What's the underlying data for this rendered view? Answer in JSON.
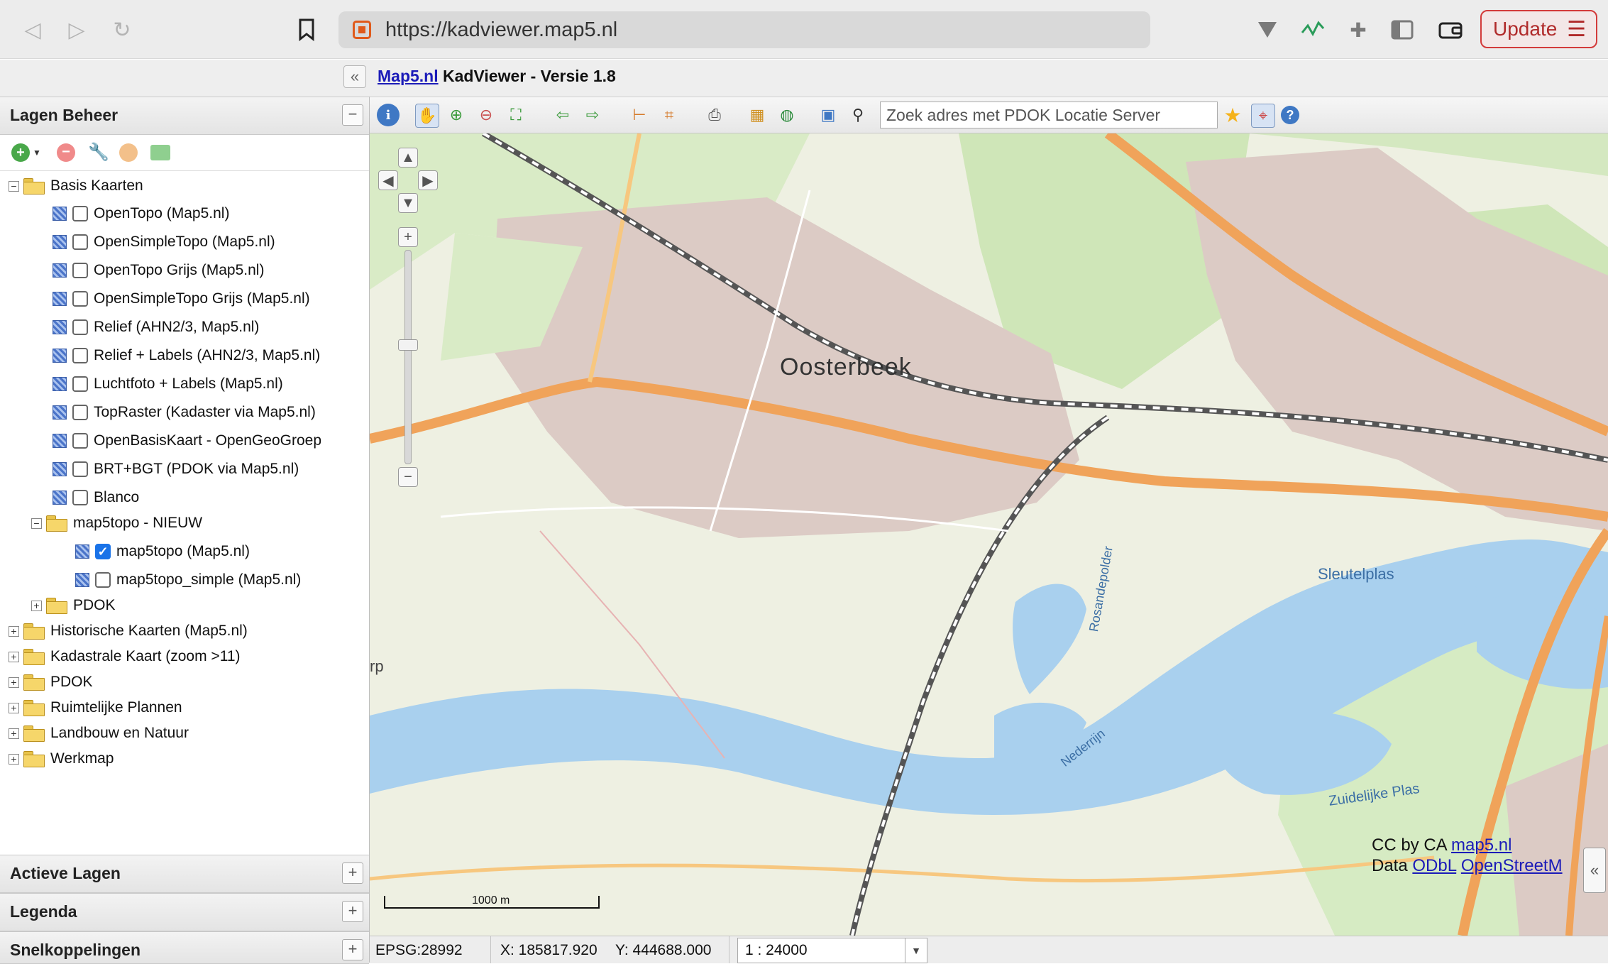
{
  "browser": {
    "url": "https://kadviewer.map5.nl",
    "update_label": "Update"
  },
  "app": {
    "title_link": "Map5.nl",
    "title_rest": " KadViewer - Versie 1.8"
  },
  "left_panel": {
    "title": "Lagen Beheer",
    "tree": {
      "basis_kaarten": "Basis Kaarten",
      "layers": [
        {
          "label": "OpenTopo (Map5.nl)",
          "checked": false
        },
        {
          "label": "OpenSimpleTopo (Map5.nl)",
          "checked": false
        },
        {
          "label": "OpenTopo Grijs (Map5.nl)",
          "checked": false
        },
        {
          "label": "OpenSimpleTopo Grijs (Map5.nl)",
          "checked": false
        },
        {
          "label": "Relief (AHN2/3, Map5.nl)",
          "checked": false
        },
        {
          "label": "Relief + Labels (AHN2/3, Map5.nl)",
          "checked": false
        },
        {
          "label": "Luchtfoto + Labels (Map5.nl)",
          "checked": false
        },
        {
          "label": "TopRaster (Kadaster via Map5.nl)",
          "checked": false
        },
        {
          "label": "OpenBasisKaart - OpenGeoGroep",
          "checked": false
        },
        {
          "label": "BRT+BGT (PDOK via Map5.nl)",
          "checked": false
        },
        {
          "label": "Blanco",
          "checked": false
        }
      ],
      "map5topo_folder": "map5topo - NIEUW",
      "map5topo_layers": [
        {
          "label": "map5topo (Map5.nl)",
          "checked": true
        },
        {
          "label": "map5topo_simple (Map5.nl)",
          "checked": false
        }
      ],
      "pdok_sub": "PDOK",
      "top_folders": [
        "Historische Kaarten (Map5.nl)",
        "Kadastrale Kaart (zoom >11)",
        "PDOK",
        "Ruimtelijke Plannen",
        "Landbouw en Natuur",
        "Werkmap"
      ]
    },
    "bottom_panels": [
      "Actieve Lagen",
      "Legenda",
      "Snelkoppelingen"
    ]
  },
  "map": {
    "search_placeholder": "Zoek adres met PDOK Locatie Server",
    "labels": {
      "town": "Oosterbeek",
      "sleutelplas": "Sleutelplas",
      "rosandepolder": "Rosandepolder",
      "nederrijn": "Nederrijn",
      "zuidelijke_plas": "Zuidelijke Plas",
      "rp": "rp"
    },
    "scale_bar": "1000 m",
    "attribution": {
      "cc": "CC by CA ",
      "cc_link": "map5.nl",
      "data": "Data ",
      "odbl": "ODbL",
      "osm": "OpenStreetM"
    }
  },
  "status": {
    "epsg": "EPSG:28992",
    "x": "X: 185817.920",
    "y": "Y: 444688.000",
    "scale": "1 : 24000"
  },
  "colors": {
    "water": "#a9d0ee",
    "road_major": "#f0a35a",
    "urban": "#d8c6c0",
    "green": "#cfe6b8",
    "link": "#1b1bb8"
  }
}
